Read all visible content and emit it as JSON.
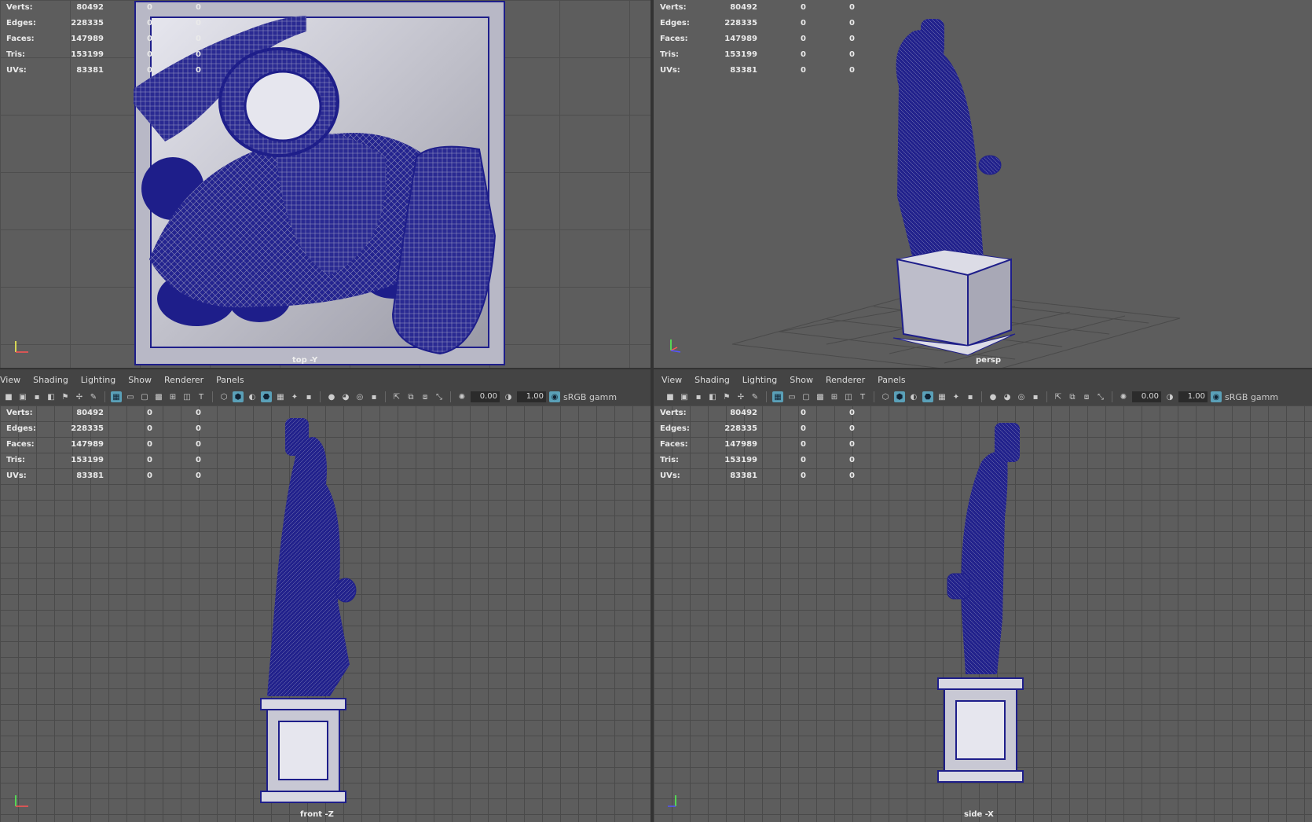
{
  "hud": {
    "labels": [
      "Verts:",
      "Edges:",
      "Faces:",
      "Tris:",
      "UVs:"
    ],
    "values": [
      "80492",
      "228335",
      "147989",
      "153199",
      "83381"
    ],
    "zeros": [
      "0",
      "0"
    ]
  },
  "menu": [
    "View",
    "Shading",
    "Lighting",
    "Show",
    "Renderer",
    "Panels"
  ],
  "toolbar": {
    "value_a": "0.00",
    "value_b": "1.00",
    "colorspace": "sRGB gamm"
  },
  "panels": {
    "top": "top -Y",
    "persp": "persp",
    "front": "front -Z",
    "side": "side -X"
  },
  "colors": {
    "wire": "#1e1e8a",
    "viewport": "#5d5d5d",
    "accent": "#5aa0b8"
  }
}
